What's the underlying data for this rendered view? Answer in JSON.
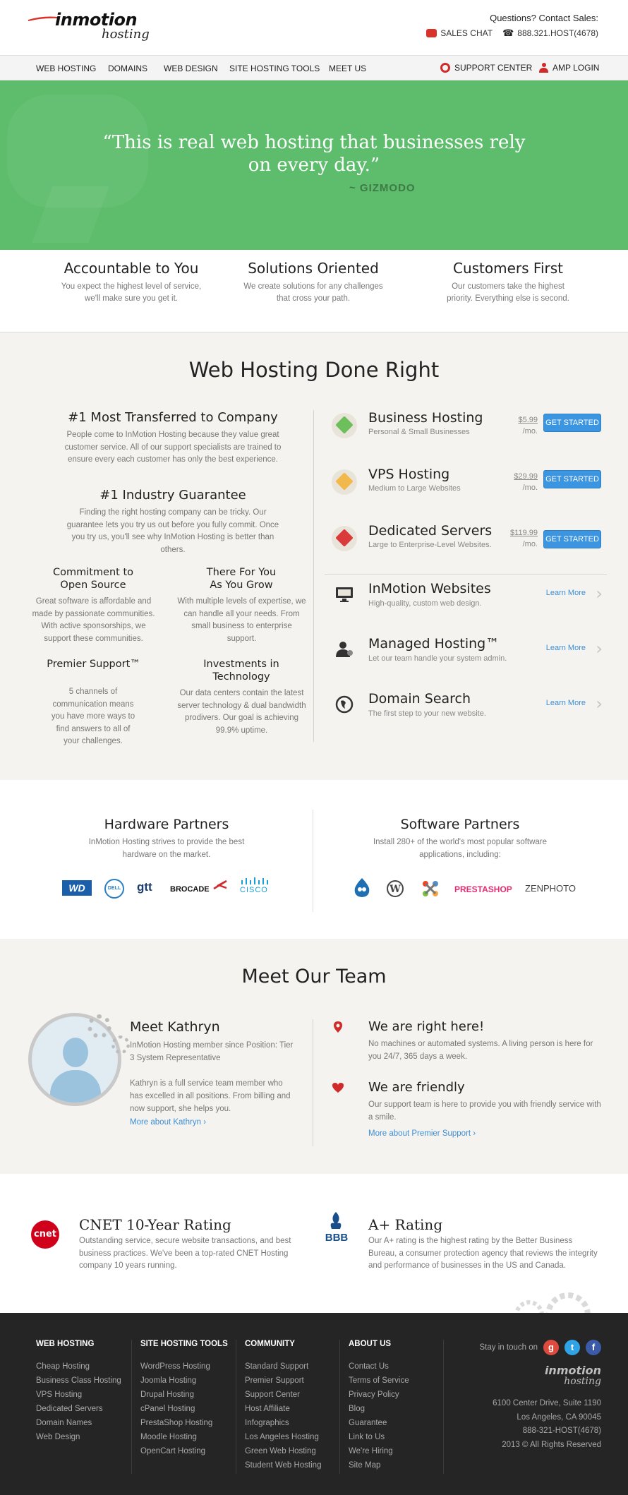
{
  "header": {
    "logo_brand": "inmotion",
    "logo_sub": "hosting",
    "contact_question": "Questions? Contact Sales:",
    "sales_chat": "SALES CHAT",
    "phone": "888.321.HOST(4678)"
  },
  "nav": {
    "items": [
      "WEB HOSTING",
      "DOMAINS",
      "WEB DESIGN",
      "SITE HOSTING TOOLS",
      "MEET US"
    ],
    "support": "SUPPORT CENTER",
    "login": "AMP LOGIN"
  },
  "hero": {
    "quote": "“This is real web hosting that businesses rely on every day.”",
    "source": "~ GIZMODO"
  },
  "values": [
    {
      "title": "Accountable to You",
      "text": "You expect the highest level of service, we'll make sure you get it."
    },
    {
      "title": "Solutions Oriented",
      "text": "We create solutions for any challenges that cross your path."
    },
    {
      "title": "Customers First",
      "text": "Our customers take the highest priority. Everything else is second."
    }
  ],
  "done_right": {
    "title": "Web Hosting Done Right",
    "features": [
      {
        "title": "#1 Most Transferred to Company",
        "text": "People come to InMotion Hosting because they value great customer service. All of our support specialists are trained to ensure every each customer has only the best experience."
      },
      {
        "title": "#1 Industry Guarantee",
        "text": "Finding the right hosting company can be tricky. Our guarantee lets you try us out before you fully commit. Once you try us, you'll see why InMotion Hosting is better than others."
      },
      {
        "title": "Commitment to Open Source",
        "text": "Great software is affordable and made by passionate communities. With active sponsorships, we support these communities."
      },
      {
        "title": "There For You As You Grow",
        "text": "With multiple levels of expertise, we can handle all your needs. From small business to enterprise support."
      },
      {
        "title": "Premier Support™",
        "text": "5 channels of communication means you have more ways to find answers to all of your challenges."
      },
      {
        "title": "Investments in Technology",
        "text": "Our data centers contain the latest server technology & dual bandwidth prodivers. Our goal is achieving 99.9% uptime."
      }
    ],
    "plans": [
      {
        "name": "Business Hosting",
        "desc": "Personal & Small Businesses",
        "price": "$5.99",
        "per": "/mo.",
        "button": "GET STARTED",
        "color": "#6cbf5a"
      },
      {
        "name": "VPS Hosting",
        "desc": "Medium to Large Websites",
        "price": "$29.99",
        "per": "/mo.",
        "button": "GET STARTED",
        "color": "#f2b84b"
      },
      {
        "name": "Dedicated Servers",
        "desc": "Large to Enterprise-Level Websites.",
        "price": "$119.99",
        "per": "/mo.",
        "button": "GET STARTED",
        "color": "#d93b3b"
      }
    ],
    "services": [
      {
        "name": "InMotion Websites",
        "desc": "High-quality, custom web design.",
        "link": "Learn More",
        "icon": "monitor-icon"
      },
      {
        "name": "Managed Hosting™",
        "desc": "Let our team handle your system admin.",
        "link": "Learn More",
        "icon": "admin-person-icon"
      },
      {
        "name": "Domain Search",
        "desc": "The first step to your new website.",
        "link": "Learn More",
        "icon": "globe-icon"
      }
    ]
  },
  "partners": {
    "hardware": {
      "title": "Hardware Partners",
      "text": "InMotion Hosting strives to provide the best hardware on the market.",
      "logos": [
        "WD",
        "DELL",
        "gtt",
        "BROCADE",
        "CISCO"
      ]
    },
    "software": {
      "title": "Software Partners",
      "text": "Install 280+ of the world's most popular software applications, including:",
      "logos": [
        "drupal",
        "wordpress",
        "joomla",
        "PRESTASHOP",
        "ZENPHOTO"
      ]
    }
  },
  "team": {
    "title": "Meet Our Team",
    "member_heading": "Meet Kathryn",
    "member_role": "InMotion Hosting member since Position: Tier 3 System Representative",
    "member_bio": "Kathryn is a full service team member who has excelled in all positions. From billing and now support, she helps you.",
    "member_link": "More about Kathryn",
    "info": [
      {
        "title": "We are right here!",
        "text": "No machines or automated systems. A living person is here for you 24/7, 365 days a week."
      },
      {
        "title": "We are friendly",
        "text": "Our support team is here to provide you with friendly service with a smile."
      }
    ],
    "support_link": "More about Premier Support"
  },
  "ratings": [
    {
      "badge": "cnet",
      "title": "CNET 10-Year Rating",
      "text": "Outstanding service, secure website transactions, and best business practices. We've been a top-rated CNET Hosting company 10 years running."
    },
    {
      "badge": "BBB",
      "title": "A+ Rating",
      "text": "Our A+ rating is the highest rating by the Better Business Bureau, a consumer protection agency that reviews the integrity and performance of businesses in the US and Canada."
    }
  ],
  "footer": {
    "columns": [
      {
        "title": "WEB HOSTING",
        "links": [
          "Cheap Hosting",
          "Business Class Hosting",
          "VPS Hosting",
          "Dedicated Servers",
          "Domain Names",
          "Web Design"
        ]
      },
      {
        "title": "SITE HOSTING TOOLS",
        "links": [
          "WordPress Hosting",
          "Joomla Hosting",
          "Drupal Hosting",
          "cPanel Hosting",
          "PrestaShop Hosting",
          "Moodle Hosting",
          "OpenCart Hosting"
        ]
      },
      {
        "title": "COMMUNITY",
        "links": [
          "Standard Support",
          "Premier Support",
          "Support Center",
          "Host Affiliate",
          "Infographics",
          "Los Angeles Hosting",
          "Green Web Hosting",
          "Student Web Hosting"
        ]
      },
      {
        "title": "ABOUT US",
        "links": [
          "Contact Us",
          "Terms of Service",
          "Privacy Policy",
          "Blog",
          "Guarantee",
          "Link to Us",
          "We're Hiring",
          "Site Map"
        ]
      }
    ],
    "stay_in_touch": "Stay in touch on",
    "logo_brand": "inmotion",
    "logo_sub": "hosting",
    "address": [
      "6100 Center Drive, Suite 1190",
      "Los Angeles, CA 90045",
      "888-321-HOST(4678)",
      "2013 © All Rights Reserved"
    ]
  }
}
